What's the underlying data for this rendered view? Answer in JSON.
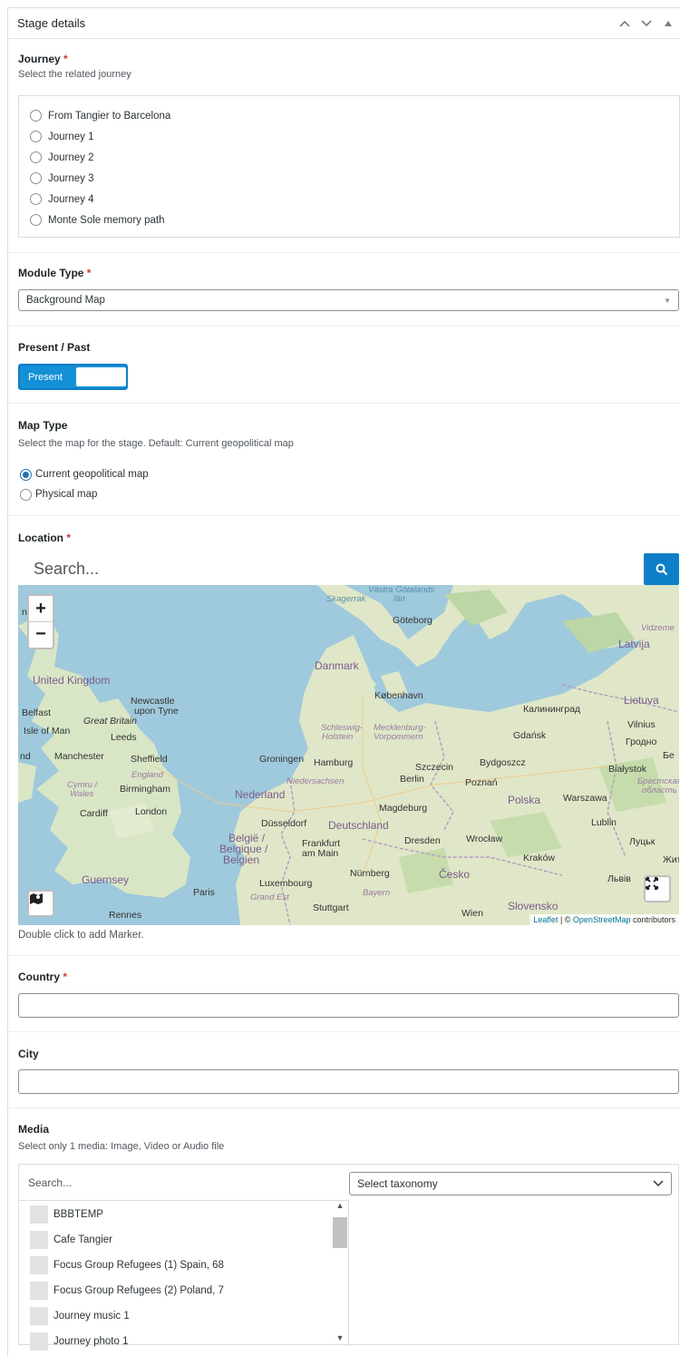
{
  "panel": {
    "title": "Stage details"
  },
  "journey": {
    "label": "Journey",
    "required_mark": "*",
    "description": "Select the related journey",
    "options": [
      "From Tangier to Barcelona",
      "Journey 1",
      "Journey 2",
      "Journey 3",
      "Journey 4",
      "Monte Sole memory path"
    ]
  },
  "module_type": {
    "label": "Module Type",
    "required_mark": "*",
    "selected": "Background Map"
  },
  "present_past": {
    "label": "Present / Past",
    "toggle_label": "Present"
  },
  "map_type": {
    "label": "Map Type",
    "description": "Select the map for the stage. Default: Current geopolitical map",
    "options": [
      {
        "label": "Current geopolitical map",
        "checked": true
      },
      {
        "label": "Physical map",
        "checked": false
      }
    ]
  },
  "location": {
    "label": "Location",
    "required_mark": "*",
    "search_placeholder": "Search...",
    "zoom_in": "+",
    "zoom_out": "−",
    "hint": "Double click to add Marker.",
    "attribution": {
      "leaflet": "Leaflet",
      "sep": " | © ",
      "osm": "OpenStreetMap",
      "suffix": " contributors"
    },
    "map_labels": {
      "vastra": "Västra Götalands",
      "lan": "län",
      "skagerrak": "Skagerrak",
      "goteborg": "Göteborg",
      "vidzeme": "Vidzeme",
      "latvija": "Latvija",
      "danmark": "Danmark",
      "united_kingdom": "United Kingdom",
      "kobenhavn": "København",
      "lietuva": "Lietuva",
      "newcastle": "Newcastle",
      "upon_tyne": "upon Tyne",
      "belfast": "Belfast",
      "great_britain": "Great Britain",
      "kaliningrad": "Калининград",
      "vilnius": "Vilnius",
      "isle_of_man": "Isle of Man",
      "leeds": "Leeds",
      "schleswig": "Schleswig-",
      "holstein": "Holstein",
      "mecklenburg": "Mecklenburg-",
      "vorpommern": "Vorpommern",
      "gdansk": "Gdańsk",
      "grodno": "Гродно",
      "manchester": "Manchester",
      "sheffield": "Sheffield",
      "groningen": "Groningen",
      "hamburg": "Hamburg",
      "szczecin": "Szczecin",
      "bydgoszcz": "Bydgoszcz",
      "bialystok": "Białystok",
      "england": "England",
      "niedersachsen": "Niedersachsen",
      "berlin": "Berlin",
      "poznan": "Poznań",
      "brest": "Брестская",
      "oblast": "область",
      "cymru": "Cymru /",
      "wales": "Wales",
      "birmingham": "Birmingham",
      "nederland": "Nederland",
      "polska": "Polska",
      "warszawa": "Warszawa",
      "cardiff": "Cardiff",
      "london": "London",
      "magdeburg": "Magdeburg",
      "dusseldorf": "Düsseldorf",
      "deutschland": "Deutschland",
      "lublin": "Lublin",
      "belgie": "België /",
      "belgique": "Belgique /",
      "belgien": "Belgien",
      "frankfurt": "Frankfurt",
      "am_main": "am Main",
      "dresden": "Dresden",
      "wroclaw": "Wrocław",
      "lutsk": "Луцьк",
      "krakow": "Kraków",
      "zhyt": "Жит",
      "guernsey": "Guernsey",
      "luxembourg": "Luxembourg",
      "nurnberg": "Nürnberg",
      "cesko": "Česko",
      "lviv": "Львів",
      "paris": "Paris",
      "grand_est": "Grand Est",
      "bayern": "Bayern",
      "rennes": "Rennes",
      "stuttgart": "Stuttgart",
      "wien": "Wien",
      "slovensko": "Slovensko",
      "nd1": "nd",
      "nd2": "nd",
      "be": "Бе"
    }
  },
  "country": {
    "label": "Country",
    "required_mark": "*",
    "value": ""
  },
  "city": {
    "label": "City",
    "value": ""
  },
  "media": {
    "label": "Media",
    "description": "Select only 1 media: Image, Video or Audio file",
    "search_placeholder": "Search...",
    "taxonomy_selected": "Select taxonomy",
    "items": [
      "BBBTEMP",
      "Cafe Tangier",
      "Focus Group Refugees (1) Spain, 68",
      "Focus Group Refugees (2) Poland, 7",
      "Journey music 1",
      "Journey photo 1"
    ]
  }
}
